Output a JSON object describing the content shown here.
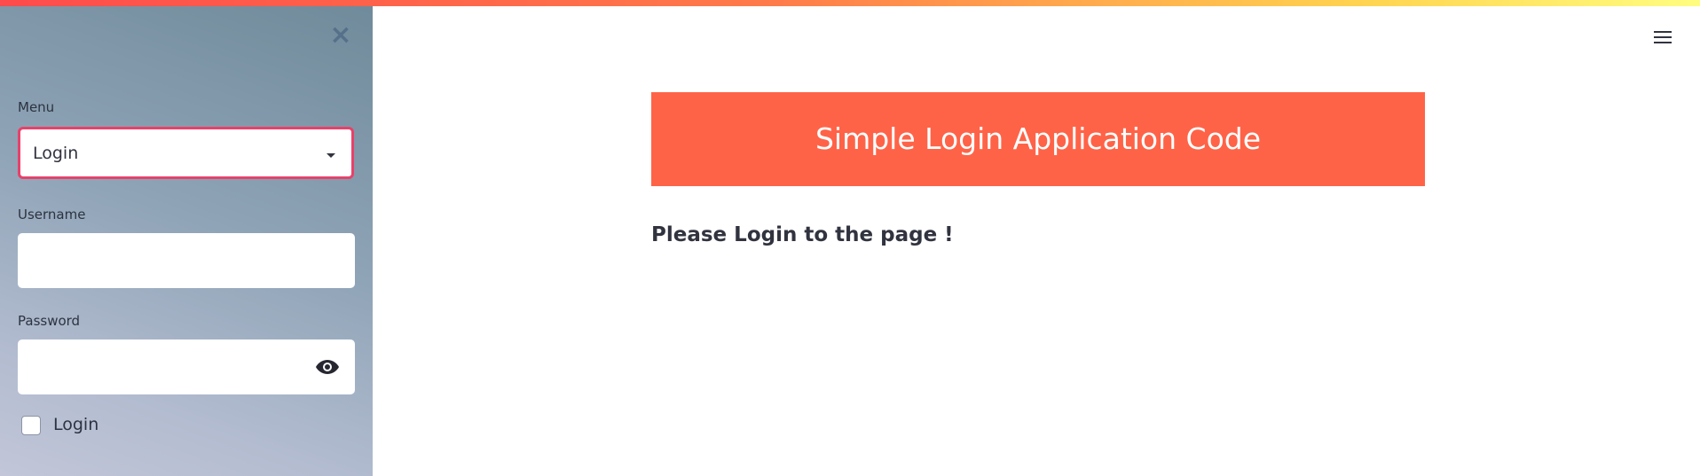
{
  "sidebar": {
    "close_icon": "close-icon",
    "menu": {
      "label": "Menu",
      "selected": "Login"
    },
    "username": {
      "label": "Username",
      "value": ""
    },
    "password": {
      "label": "Password",
      "value": "",
      "toggle_icon": "eye-icon"
    },
    "login_checkbox": {
      "label": "Login",
      "checked": false
    }
  },
  "topbar": {
    "menu_icon": "hamburger-icon"
  },
  "main": {
    "header": "Simple Login Application Code",
    "subheading": "Please Login to the page !"
  },
  "colors": {
    "banner": "#ff6347",
    "select_border": "#e8416a",
    "sidebar_top": "#6f8a9a",
    "sidebar_bottom": "#c2c6d8"
  }
}
